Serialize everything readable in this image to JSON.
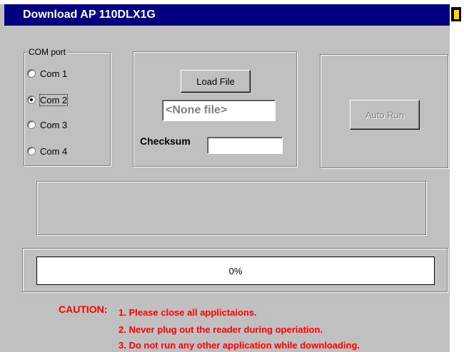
{
  "window": {
    "title": "Download AP 110DLX1G"
  },
  "com_port": {
    "title": "COM port",
    "options": [
      "Com 1",
      "Com 2",
      "Com 3",
      "Com 4"
    ],
    "selected": "Com 2"
  },
  "file": {
    "load_button": "Load File",
    "filename_value": "<None file>",
    "checksum_label": "Checksum",
    "checksum_value": ""
  },
  "auto_run": {
    "label": "Auto Run",
    "enabled": false
  },
  "progress": {
    "text": "0%",
    "fraction": 0
  },
  "caution": {
    "label": "CAUTION:",
    "notes": [
      "1. Please close all applictaions.",
      "2. Never plug out the reader during operiation.",
      "3. Do not run any other application while downloading."
    ]
  },
  "colors": {
    "titlebar": "#000080",
    "caution": "#ff0000",
    "face": "#c0c0c0"
  }
}
